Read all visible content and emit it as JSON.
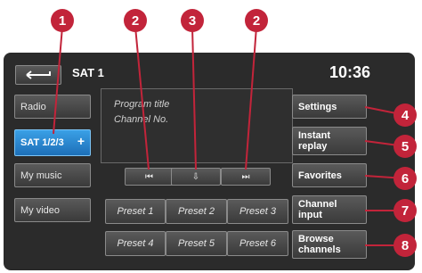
{
  "header": {
    "title": "SAT 1",
    "time": "10:36"
  },
  "left_menu": [
    {
      "label": "Radio"
    },
    {
      "label": "SAT 1/2/3",
      "suffix": "+"
    },
    {
      "label": "My music"
    },
    {
      "label": "My video"
    }
  ],
  "info_panel": {
    "line1": "Program title",
    "line2": "Channel No."
  },
  "controls": {
    "prev": "⏮",
    "mid": "⇩",
    "next": "⏭"
  },
  "presets": [
    "Preset 1",
    "Preset 2",
    "Preset 3",
    "Preset 4",
    "Preset 5",
    "Preset 6"
  ],
  "right_menu": {
    "settings": "Settings",
    "instant_replay": [
      "Instant",
      "replay"
    ],
    "favorites": "Favorites",
    "channel_input": [
      "Channel",
      "input"
    ],
    "browse_channels": [
      "Browse",
      "channels"
    ]
  },
  "callouts": [
    "1",
    "2",
    "3",
    "2",
    "4",
    "5",
    "6",
    "7",
    "8"
  ],
  "colors": {
    "callout": "#c2243a",
    "selected": "#1d6fb8",
    "screen": "#2b2b2b"
  }
}
